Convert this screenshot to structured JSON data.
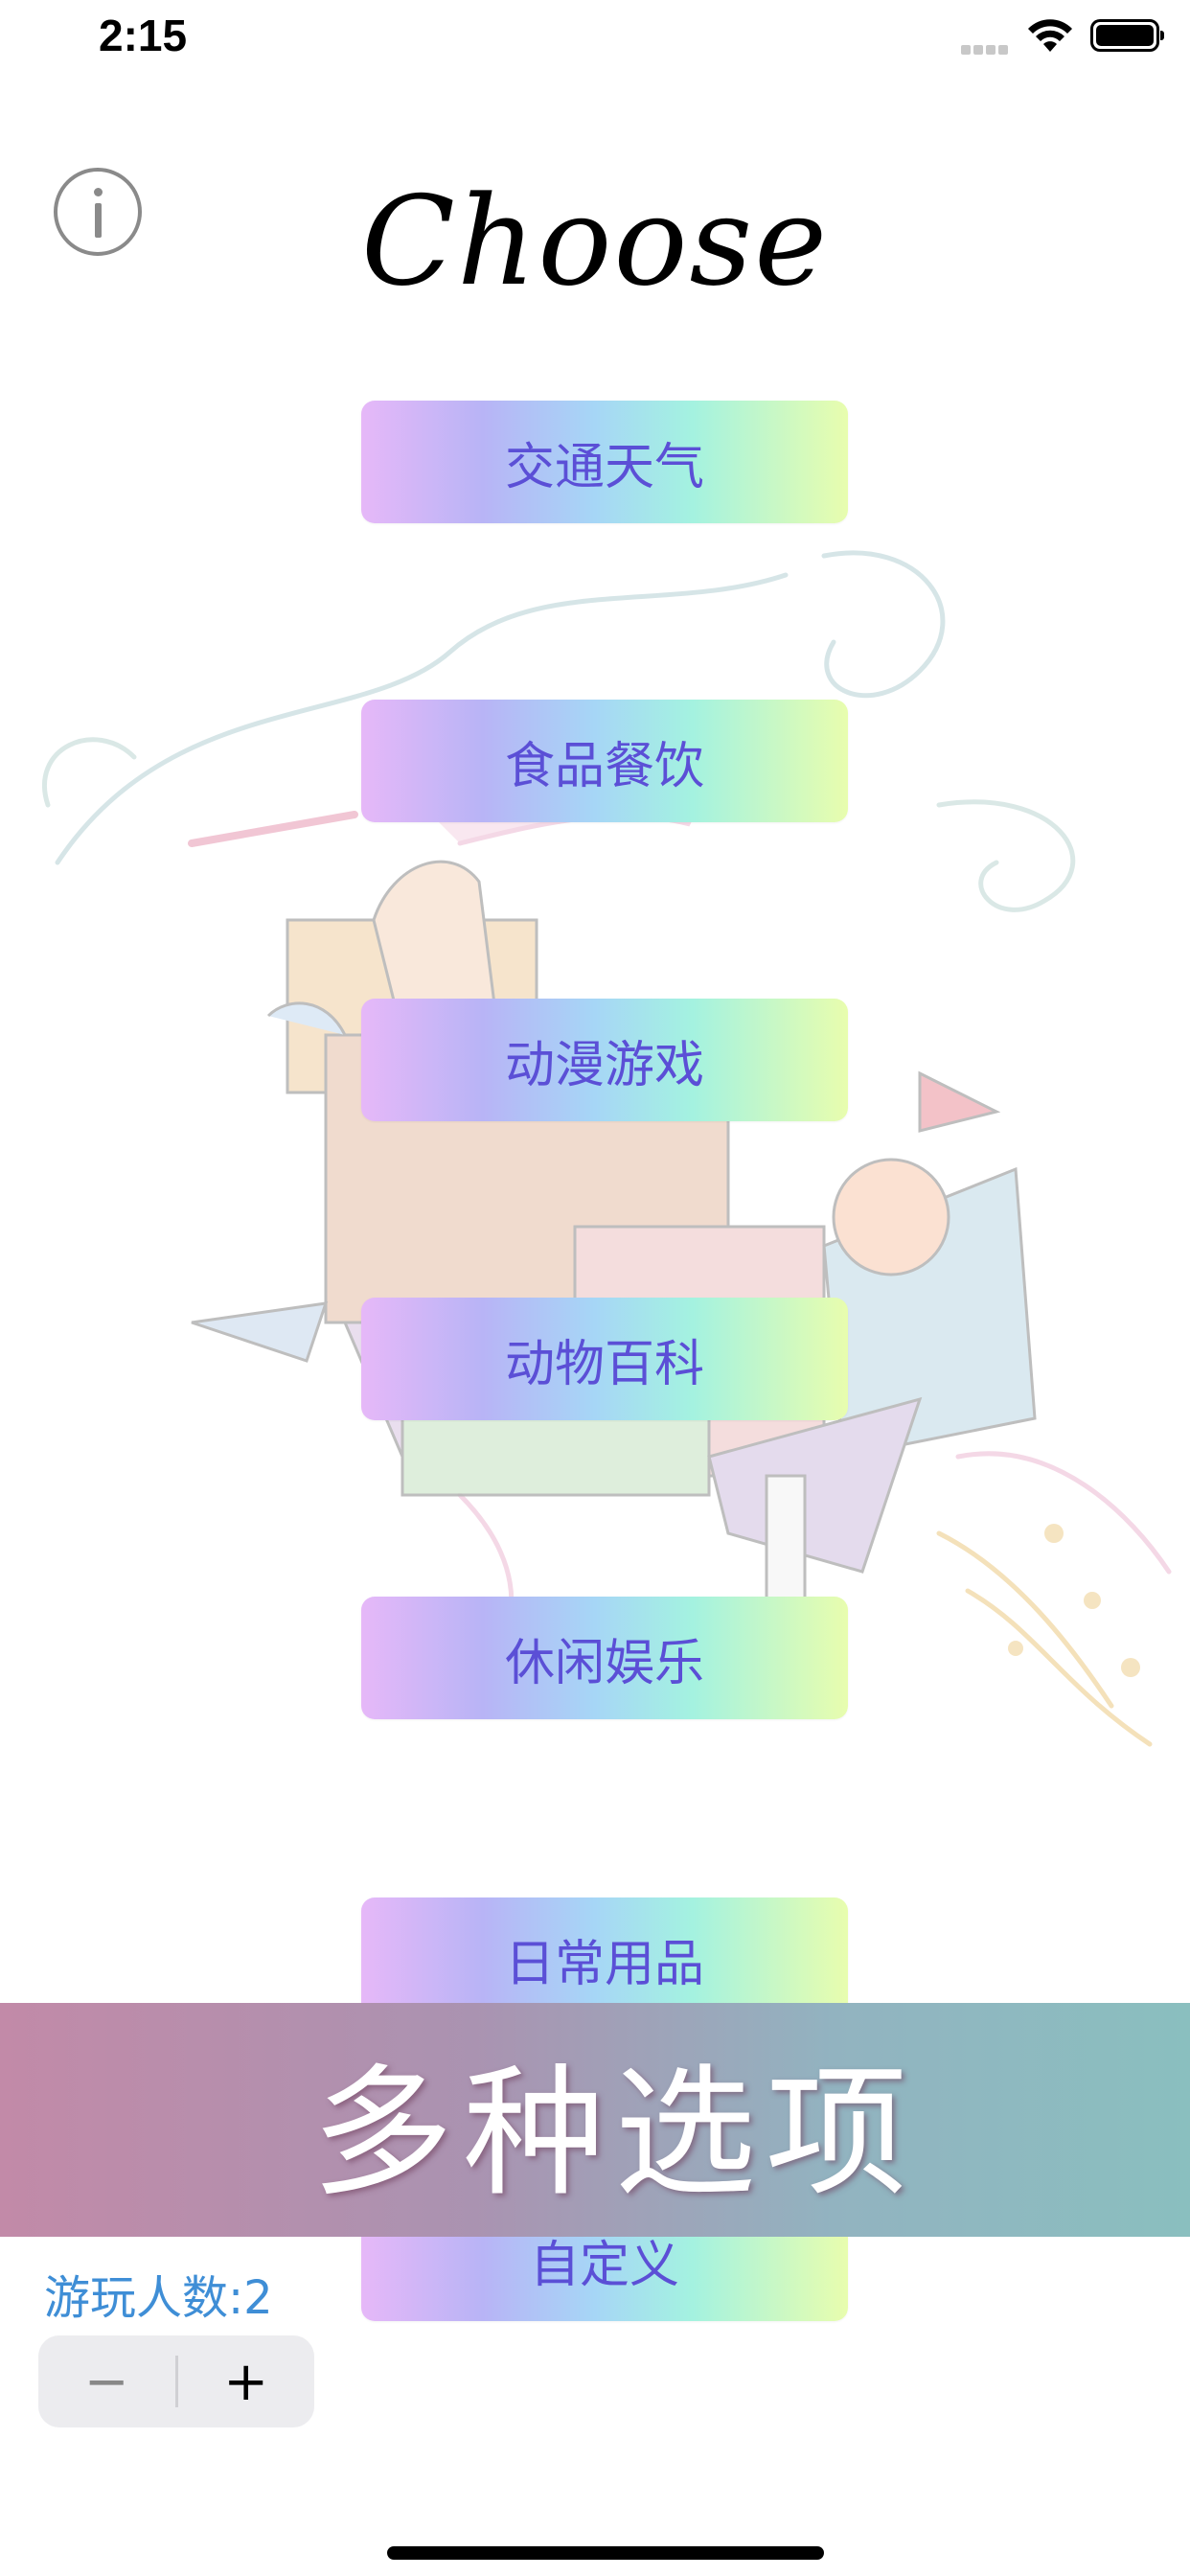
{
  "status_bar": {
    "time": "2:15"
  },
  "header": {
    "info_icon": "info-circle-icon",
    "title": "Choose"
  },
  "categories": [
    {
      "label": "交通天气"
    },
    {
      "label": "食品餐饮"
    },
    {
      "label": "动漫游戏"
    },
    {
      "label": "动物百科"
    },
    {
      "label": "休闲娱乐"
    },
    {
      "label": "日常用品"
    },
    {
      "label": "自定义"
    }
  ],
  "promo_banner": {
    "text": "多种选项"
  },
  "players": {
    "label": "游玩人数:2",
    "decrement": "−",
    "increment": "+"
  },
  "colors": {
    "button_text": "#5b4fd6",
    "player_count_text": "#3f8ed6",
    "banner_left": "#c28aa8",
    "banner_right": "#8abfbf"
  }
}
